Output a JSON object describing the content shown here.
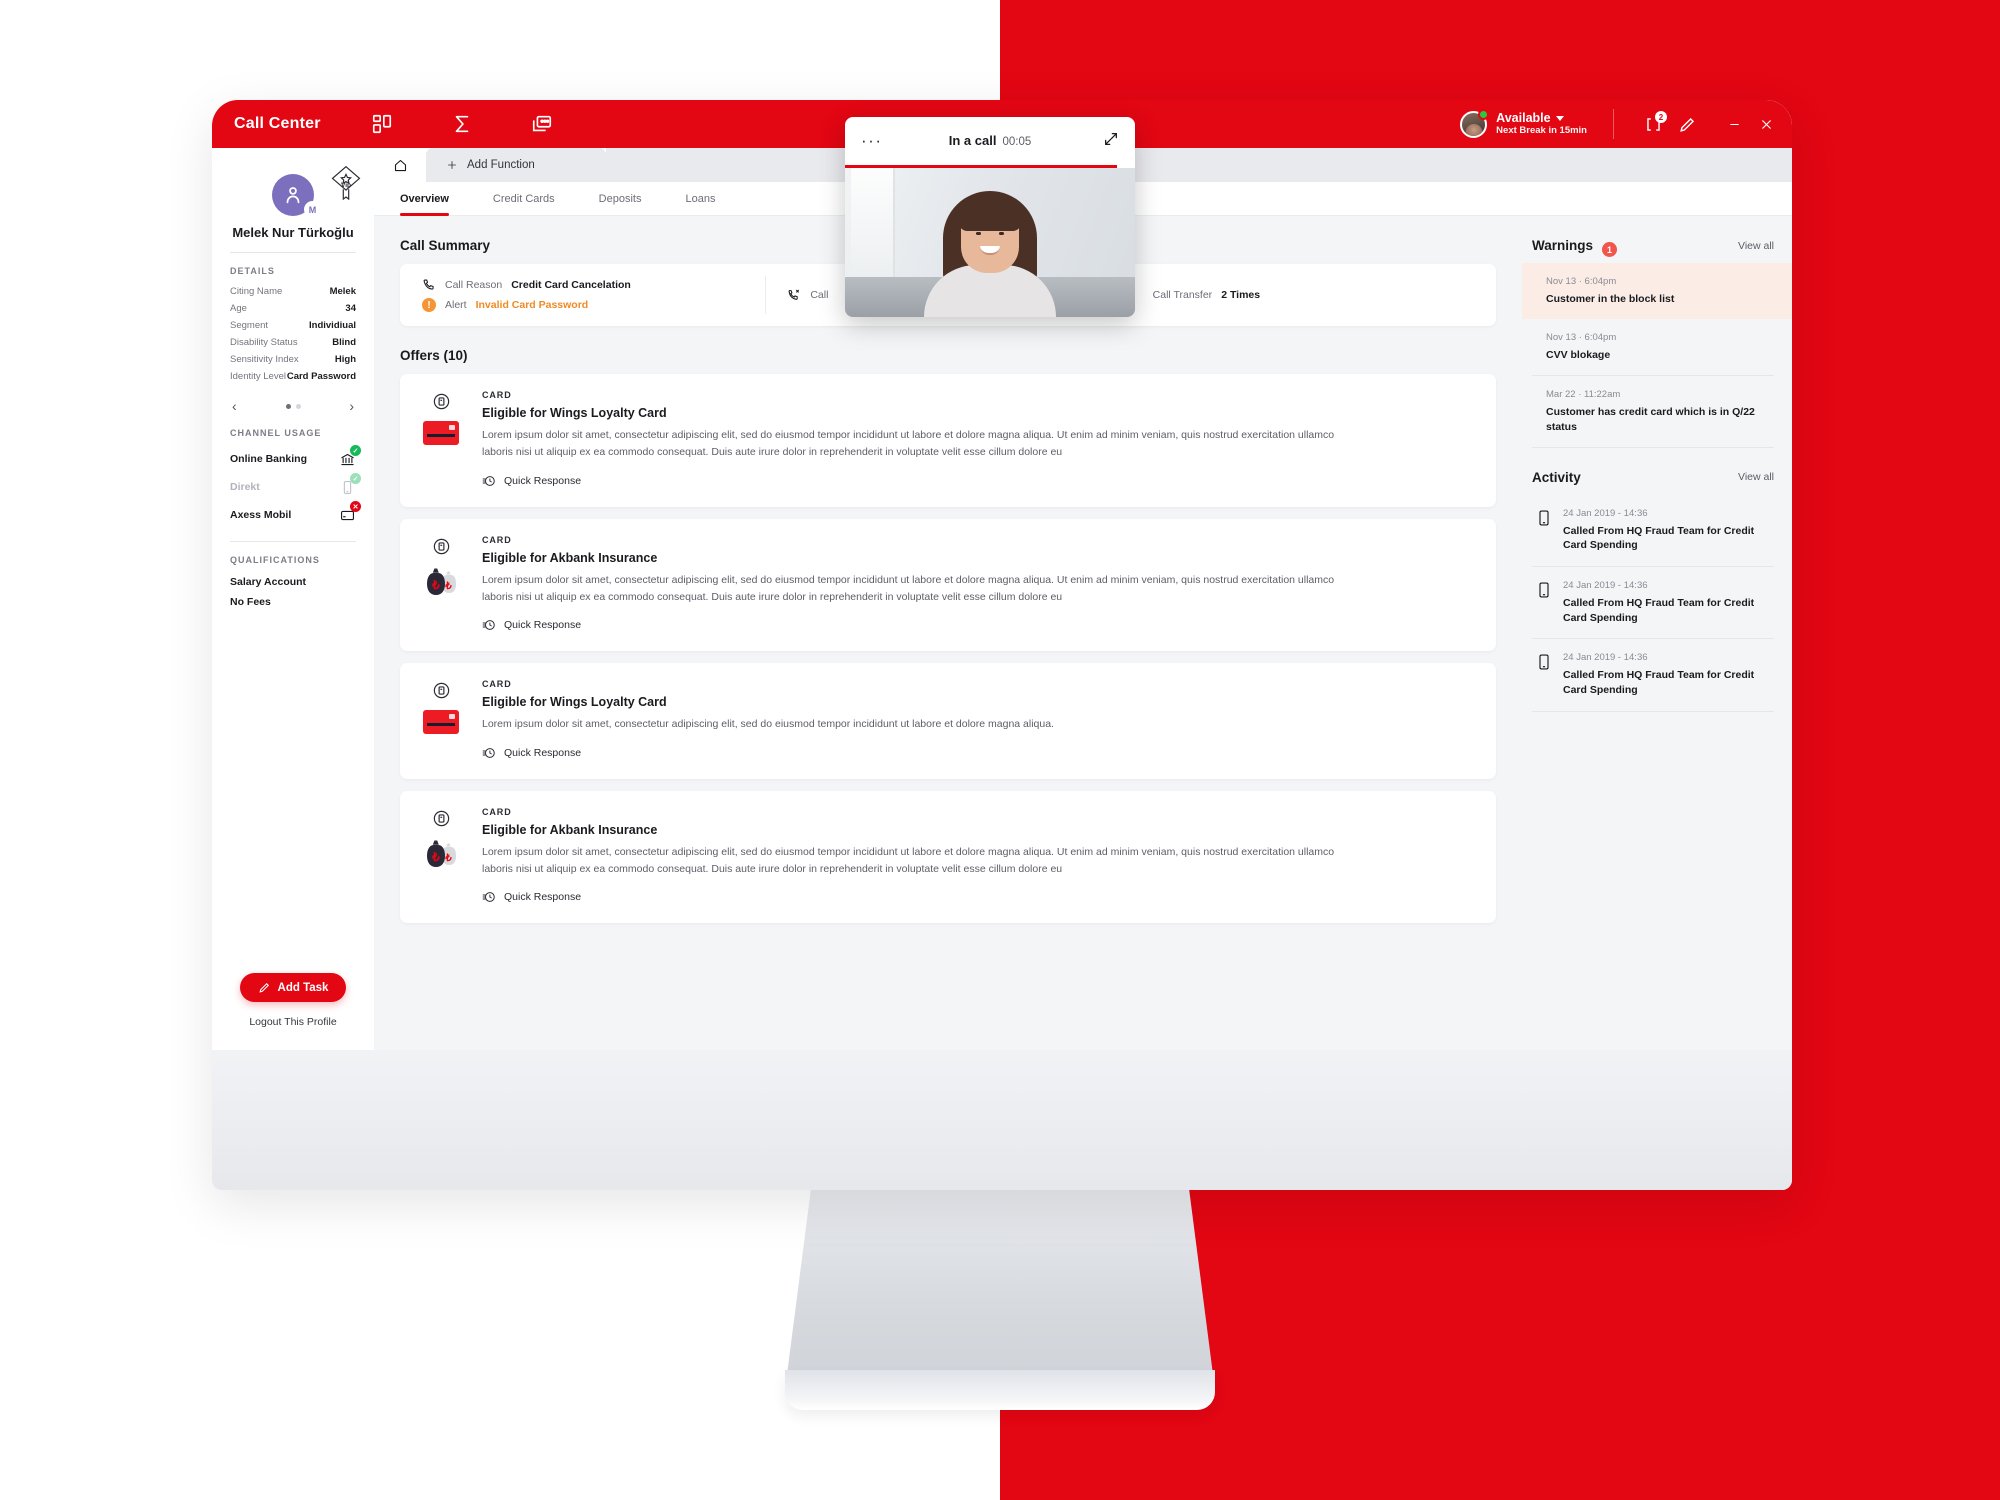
{
  "header": {
    "brand": "Call Center",
    "nav_icons": [
      "dashboard-icon",
      "sigma-icon",
      "screens-icon",
      "headset-icon"
    ],
    "agent": {
      "status": "Available",
      "sub": "Next Break in 15min"
    },
    "notification_badge": "2",
    "icons": [
      "notification-icon",
      "pen-icon",
      "minimize-icon",
      "close-icon"
    ]
  },
  "sidebar": {
    "vip_label": "Vip",
    "avatar_initial": "M",
    "customer_name": "Melek Nur Türkoğlu",
    "details_title": "DETAILS",
    "details": [
      {
        "label": "Citing Name",
        "value": "Melek"
      },
      {
        "label": "Age",
        "value": "34"
      },
      {
        "label": "Segment",
        "value": "Individiual"
      },
      {
        "label": "Disability Status",
        "value": "Blind"
      },
      {
        "label": "Sensitivity Index",
        "value": "High"
      },
      {
        "label": "Identity Level",
        "value": "Card Password"
      }
    ],
    "channel_title": "CHANNEL USAGE",
    "channels": [
      {
        "label": "Online Banking",
        "icon": "bank-icon",
        "state": "ok"
      },
      {
        "label": "Direkt",
        "icon": "mobile-icon",
        "state": "ok-faded"
      },
      {
        "label": "Axess Mobil",
        "icon": "card-icon",
        "state": "no"
      }
    ],
    "qualifications_title": "QUALIFICATIONS",
    "qualifications": [
      "Salary Account",
      "No Fees"
    ],
    "add_task_label": "Add Task",
    "logout_label": "Logout This Profile"
  },
  "tabstrip": {
    "home_icon": "home-icon",
    "add_function_label": "Add Function"
  },
  "subtabs": [
    {
      "label": "Overview",
      "active": true
    },
    {
      "label": "Credit Cards",
      "active": false
    },
    {
      "label": "Deposits",
      "active": false
    },
    {
      "label": "Loans",
      "active": false
    }
  ],
  "call_summary": {
    "title": "Call Summary",
    "call_reason_label": "Call Reason",
    "call_reason_value": "Credit Card Cancelation",
    "alert_label": "Alert",
    "alert_value": "Invalid Card Password",
    "call_middle_label": "Call",
    "call_transfer_label": "Call Transfer",
    "call_transfer_value": "2 Times"
  },
  "offers": {
    "title": "Offers (10)",
    "quick_response_label": "Quick Response",
    "items": [
      {
        "kicker": "CARD",
        "title": "Eligible for Wings Loyalty Card",
        "desc": "Lorem ipsum dolor sit amet, consectetur adipiscing elit, sed do eiusmod tempor incididunt ut labore et dolore magna aliqua. Ut enim ad minim veniam, quis nostrud exercitation ullamco laboris nisi ut aliquip ex ea commodo consequat. Duis aute irure dolor in reprehenderit in voluptate velit esse cillum dolore eu",
        "art": "card"
      },
      {
        "kicker": "CARD",
        "title": "Eligible for Akbank Insurance",
        "desc": "Lorem ipsum dolor sit amet, consectetur adipiscing elit, sed do eiusmod tempor incididunt ut labore et dolore magna aliqua. Ut enim ad minim veniam, quis nostrud exercitation ullamco laboris nisi ut aliquip ex ea commodo consequat. Duis aute irure dolor in reprehenderit in voluptate velit esse cillum dolore eu",
        "art": "bag"
      },
      {
        "kicker": "CARD",
        "title": "Eligible for Wings Loyalty Card",
        "desc": "Lorem ipsum dolor sit amet, consectetur adipiscing elit, sed do eiusmod tempor incididunt ut labore et dolore magna aliqua.",
        "art": "card"
      },
      {
        "kicker": "CARD",
        "title": "Eligible for Akbank Insurance",
        "desc": "Lorem ipsum dolor sit amet, consectetur adipiscing elit, sed do eiusmod tempor incididunt ut labore et dolore magna aliqua. Ut enim ad minim veniam, quis nostrud exercitation ullamco laboris nisi ut aliquip ex ea commodo consequat. Duis aute irure dolor in reprehenderit in voluptate velit esse cillum dolore eu",
        "art": "bag"
      }
    ]
  },
  "warnings": {
    "title": "Warnings",
    "badge": "1",
    "view_all": "View all",
    "items": [
      {
        "time": "Nov 13 · 6:04pm",
        "text": "Customer in the block list",
        "highlight": true
      },
      {
        "time": "Nov 13 · 6:04pm",
        "text": "CVV blokage",
        "highlight": false
      },
      {
        "time": "Mar 22 · 11:22am",
        "text": "Customer has credit card which is in Q/22 status",
        "highlight": false
      }
    ]
  },
  "activity": {
    "title": "Activity",
    "view_all": "View all",
    "items": [
      {
        "time": "24 Jan 2019 - 14:36",
        "text": "Called From HQ Fraud Team for Credit Card Spending"
      },
      {
        "time": "24 Jan 2019 - 14:36",
        "text": "Called From HQ Fraud Team for Credit Card Spending"
      },
      {
        "time": "24 Jan 2019 - 14:36",
        "text": "Called From HQ Fraud Team for Credit Card Spending"
      }
    ]
  },
  "videocall": {
    "menu": "···",
    "title": "In a call",
    "timer": "00:05"
  },
  "colors": {
    "brand_red": "#E30613",
    "alert_orange": "#F08A24",
    "warning_bg": "#FBEDE6",
    "badge_red": "#F2554B",
    "avatar_purple": "#7B6FBE"
  }
}
